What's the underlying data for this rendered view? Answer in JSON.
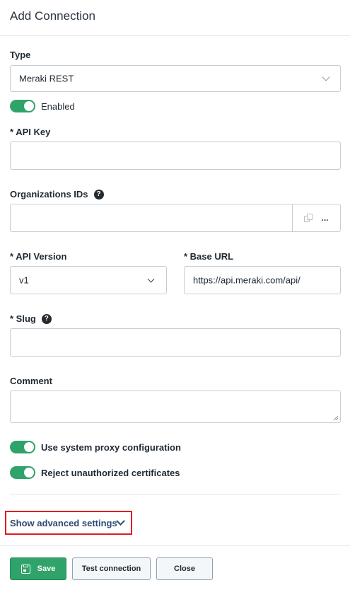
{
  "dialog": {
    "title": "Add Connection"
  },
  "form": {
    "type": {
      "label": "Type",
      "value": "Meraki REST"
    },
    "enabled": {
      "label": "Enabled",
      "on": true
    },
    "api_key": {
      "label": "* API Key",
      "value": ""
    },
    "org_ids": {
      "label": "Organizations IDs",
      "value": "",
      "more_label": "..."
    },
    "api_version": {
      "label": "* API Version",
      "value": "v1"
    },
    "base_url": {
      "label": "* Base URL",
      "value": "https://api.meraki.com/api/"
    },
    "slug": {
      "label": "* Slug",
      "value": ""
    },
    "comment": {
      "label": "Comment",
      "value": ""
    },
    "system_proxy": {
      "label": "Use system proxy configuration",
      "on": true
    },
    "reject_unauthorized": {
      "label": "Reject unauthorized certificates",
      "on": true
    },
    "advanced": {
      "label": "Show advanced settings"
    }
  },
  "help_icon_glyph": "?",
  "footer": {
    "save_label": "Save",
    "test_label": "Test connection",
    "close_label": "Close"
  },
  "colors": {
    "accent_green": "#2fa36a",
    "highlight_red": "#e11b22",
    "link_blue": "#2d4a73"
  },
  "icons": [
    "chevron-down-icon",
    "help-icon",
    "copy-icon",
    "save-icon"
  ]
}
